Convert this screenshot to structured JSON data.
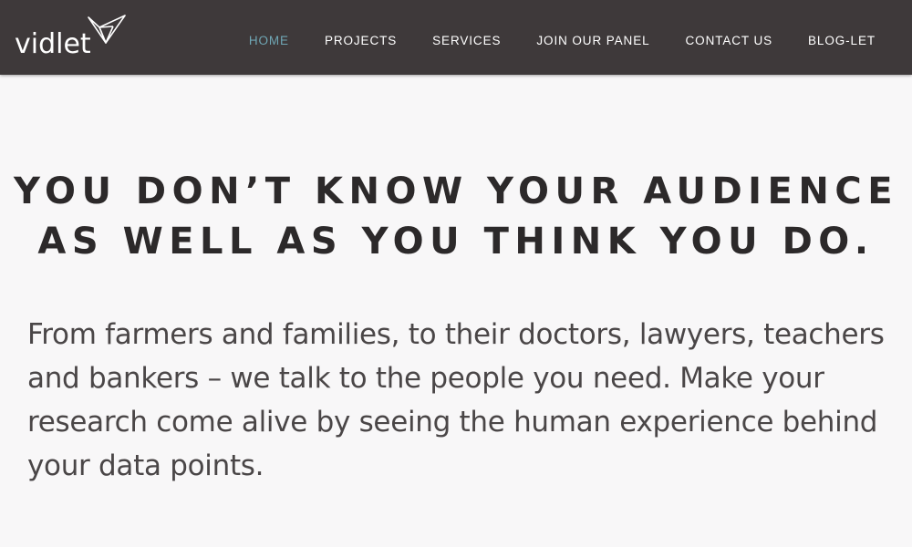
{
  "brand": {
    "name": "vidlet",
    "mark_icon": "origami-crane-icon"
  },
  "nav": {
    "items": [
      {
        "label": "HOME",
        "active": true
      },
      {
        "label": "PROJECTS",
        "active": false
      },
      {
        "label": "SERVICES",
        "active": false
      },
      {
        "label": "JOIN OUR PANEL",
        "active": false
      },
      {
        "label": "CONTACT US",
        "active": false
      },
      {
        "label": "BLOG-LET",
        "active": false
      }
    ]
  },
  "hero": {
    "headline_line1": "YOU DON’T KNOW YOUR AUDIENCE",
    "headline_line2": "AS WELL AS YOU THINK YOU DO.",
    "body": "From farmers and families, to their doctors, lawyers, teachers and bankers – we talk to the people you need. Make your research come alive by seeing the human experience behind your data points."
  },
  "colors": {
    "nav_background": "#3e393a",
    "nav_text": "#ffffff",
    "nav_active": "#6fa6b4",
    "page_background": "#f8f7f8",
    "headline_text": "#2c292a",
    "body_text": "#4a4647"
  }
}
